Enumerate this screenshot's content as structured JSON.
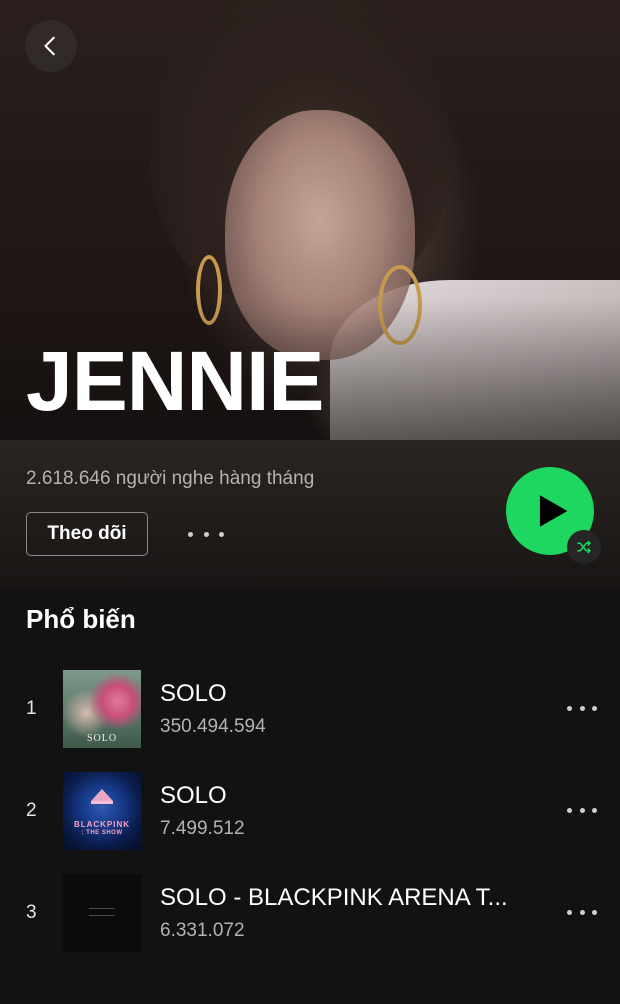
{
  "header": {
    "artist_name": "JENNIE"
  },
  "stats": {
    "monthly_listeners": "2.618.646 người nghe hàng tháng"
  },
  "actions": {
    "follow_label": "Theo dõi"
  },
  "popular": {
    "title": "Phổ biến",
    "tracks": [
      {
        "rank": "1",
        "title": "SOLO",
        "plays": "350.494.594",
        "cover_text": "SOLO"
      },
      {
        "rank": "2",
        "title": "SOLO",
        "plays": "7.499.512",
        "cover_text": "BLACKPINK",
        "cover_subtext": ": THE SHOW"
      },
      {
        "rank": "3",
        "title": "SOLO - BLACKPINK ARENA T...",
        "plays": "6.331.072"
      }
    ]
  },
  "colors": {
    "accent_green": "#1ed760",
    "background": "#121212",
    "secondary_text": "#b3b3b3"
  },
  "icons": [
    "back-arrow-icon",
    "more-options-icon",
    "play-icon",
    "shuffle-icon"
  ]
}
